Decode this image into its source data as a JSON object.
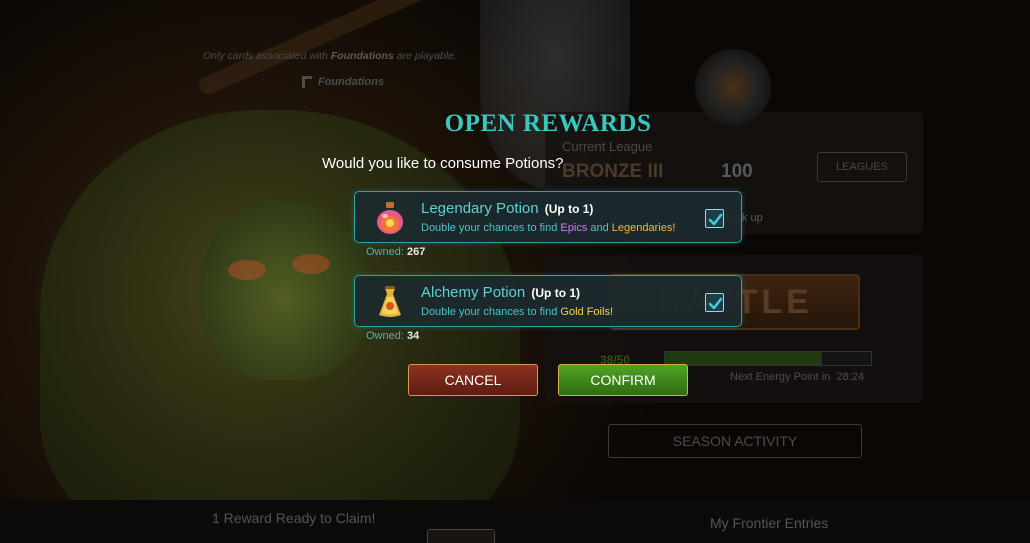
{
  "background": {
    "playable_note_prefix": "Only cards associated with ",
    "playable_note_format": "Foundations",
    "playable_note_suffix": " are playable.",
    "format_badge": "Foundations",
    "current_league_label": "Current League",
    "league_name": "BRONZE III",
    "league_rating": "100",
    "leagues_button": "LEAGUES",
    "rank_up_text": "rank up",
    "battle_button": "BATTLE",
    "energy_text": "38/50",
    "energy_fraction": 0.76,
    "next_energy_label": "Next Energy Point in",
    "next_energy_time": "28:24",
    "season_activity_button": "SEASON ACTIVITY",
    "reward_ready_text": "1 Reward Ready to Claim!",
    "frontier_entries_label": "My Frontier Entries"
  },
  "modal": {
    "title": "OPEN REWARDS",
    "question": "Would you like to consume Potions?",
    "potions": [
      {
        "icon": "legendary-potion-icon",
        "name": "Legendary Potion",
        "limit": "(Up to 1)",
        "desc_prefix": "Double your chances to find ",
        "desc_hl1": "Epics",
        "desc_mid": " and ",
        "desc_hl2": "Legendaries!",
        "checked": true,
        "owned_label": "Owned:",
        "owned_count": "267"
      },
      {
        "icon": "alchemy-potion-icon",
        "name": "Alchemy Potion",
        "limit": "(Up to 1)",
        "desc_prefix": "Double your chances to find ",
        "desc_hl1": "Gold Foils!",
        "checked": true,
        "owned_label": "Owned:",
        "owned_count": "34"
      }
    ],
    "cancel_label": "CANCEL",
    "confirm_label": "CONFIRM"
  },
  "colors": {
    "title_teal": "#38c8bd",
    "card_border": "#2aa3a3",
    "cancel_red": "#8c3221",
    "confirm_green": "#52a325",
    "epic_purple": "#d17bf5",
    "legendary_orange": "#f3b83c",
    "gold_yellow": "#f1d640"
  }
}
